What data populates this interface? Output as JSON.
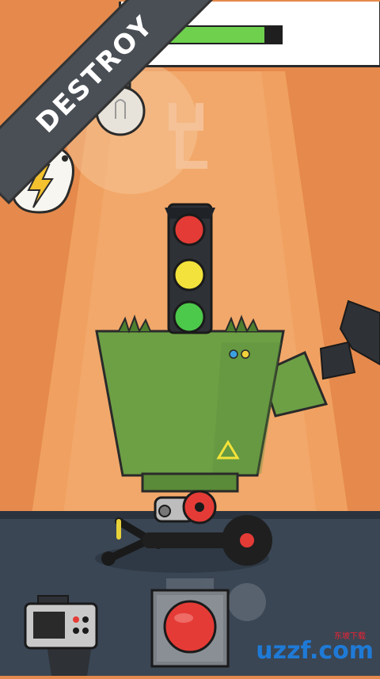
{
  "ribbon": {
    "label": "DESTROY"
  },
  "hud": {
    "health_fraction": 0.85
  },
  "watermark": {
    "logo_text": "uzzf.com",
    "small_text": "东坡下载"
  },
  "icons": {
    "lightbulb": "lightbulb-icon",
    "energy": "lightning-icon",
    "camera": "camera-icon",
    "button": "red-push-button-icon"
  },
  "colors": {
    "background": "#E58A4C",
    "stage_beam": "#F2B07E",
    "robot_body": "#6DA045",
    "traffic_red": "#E53B36",
    "traffic_yellow": "#F2E23B",
    "traffic_green": "#4CC94A",
    "floor": "#3A4654",
    "ribbon": "#4A4E55",
    "health": "#6FD04E"
  }
}
